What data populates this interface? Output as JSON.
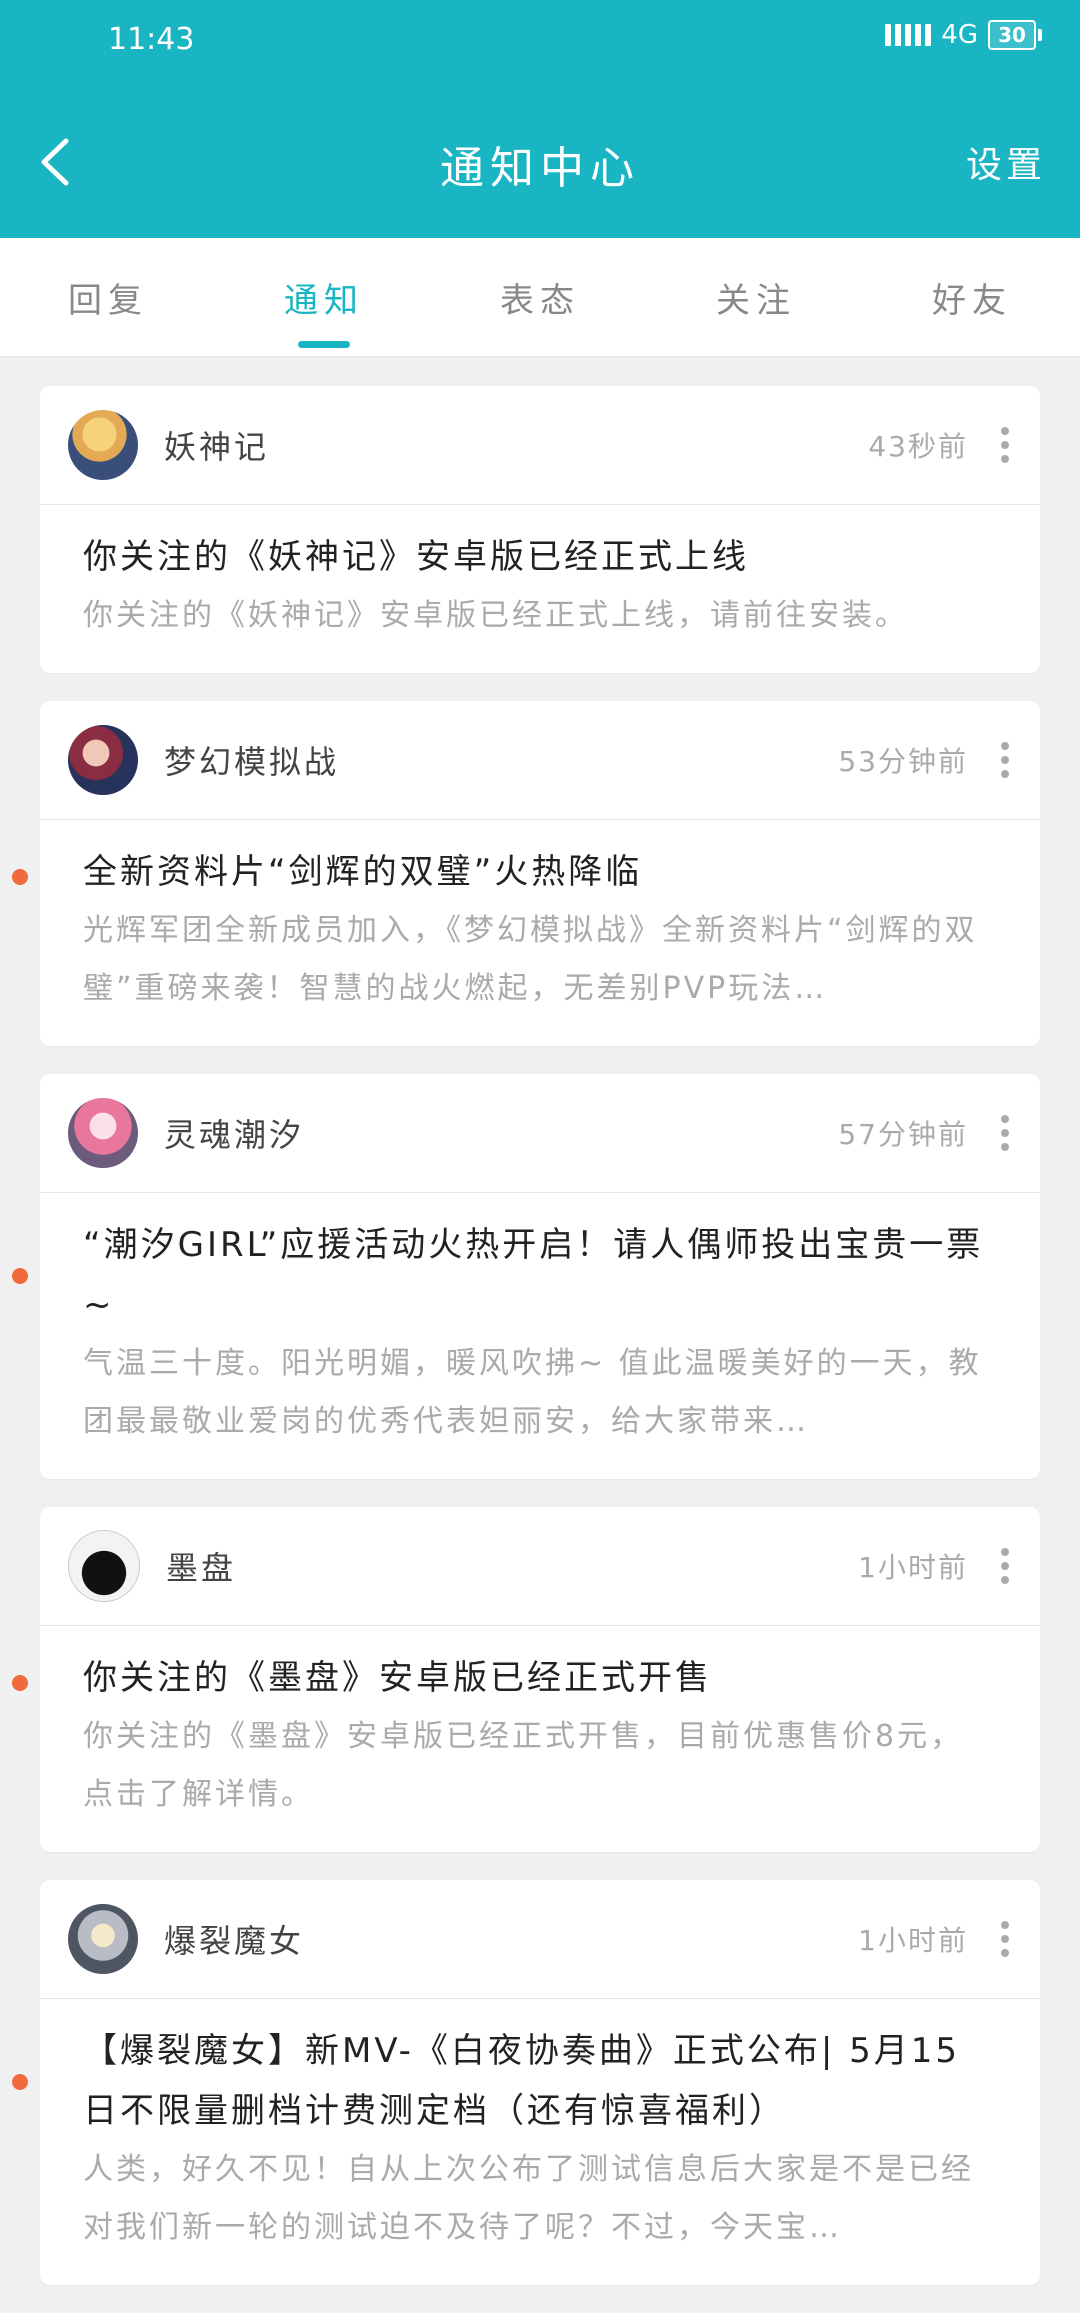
{
  "status_bar": {
    "time": "11:43",
    "network": "4G",
    "battery": "30"
  },
  "header": {
    "title": "通知中心",
    "settings_label": "设置"
  },
  "tabs": [
    {
      "label": "回复",
      "active": false
    },
    {
      "label": "通知",
      "active": true
    },
    {
      "label": "表态",
      "active": false
    },
    {
      "label": "关注",
      "active": false
    },
    {
      "label": "好友",
      "active": false
    }
  ],
  "notifications": [
    {
      "app": "妖神记",
      "time": "43秒前",
      "title": "你关注的《妖神记》安卓版已经正式上线",
      "desc": "你关注的《妖神记》安卓版已经正式上线，请前往安装。",
      "unread": false
    },
    {
      "app": "梦幻模拟战",
      "time": "53分钟前",
      "title": "全新资料片“剑辉的双璧”火热降临",
      "desc": "光辉军团全新成员加入，《梦幻模拟战》全新资料片“剑辉的双璧”重磅来袭！智慧的战火燃起，无差别PVP玩法…",
      "unread": true
    },
    {
      "app": "灵魂潮汐",
      "time": "57分钟前",
      "title": "“潮汐GIRL”应援活动火热开启！请人偶师投出宝贵一票~",
      "desc": "气温三十度。阳光明媚，暖风吹拂~ 值此温暖美好的一天，教团最最敬业爱岗的优秀代表妲丽安，给大家带来…",
      "unread": true
    },
    {
      "app": "墨盘",
      "time": "1小时前",
      "title": "你关注的《墨盘》安卓版已经正式开售",
      "desc": "你关注的《墨盘》安卓版已经正式开售，目前优惠售价8元，点击了解详情。",
      "unread": true
    },
    {
      "app": "爆裂魔女",
      "time": "1小时前",
      "title": "【爆裂魔女】新MV-《白夜协奏曲》正式公布| 5月15日不限量删档计费测定档（还有惊喜福利）",
      "desc": "人类，好久不见！自从上次公布了测试信息后大家是不是已经对我们新一轮的测试迫不及待了呢？不过，今天宝…",
      "unread": true
    }
  ]
}
